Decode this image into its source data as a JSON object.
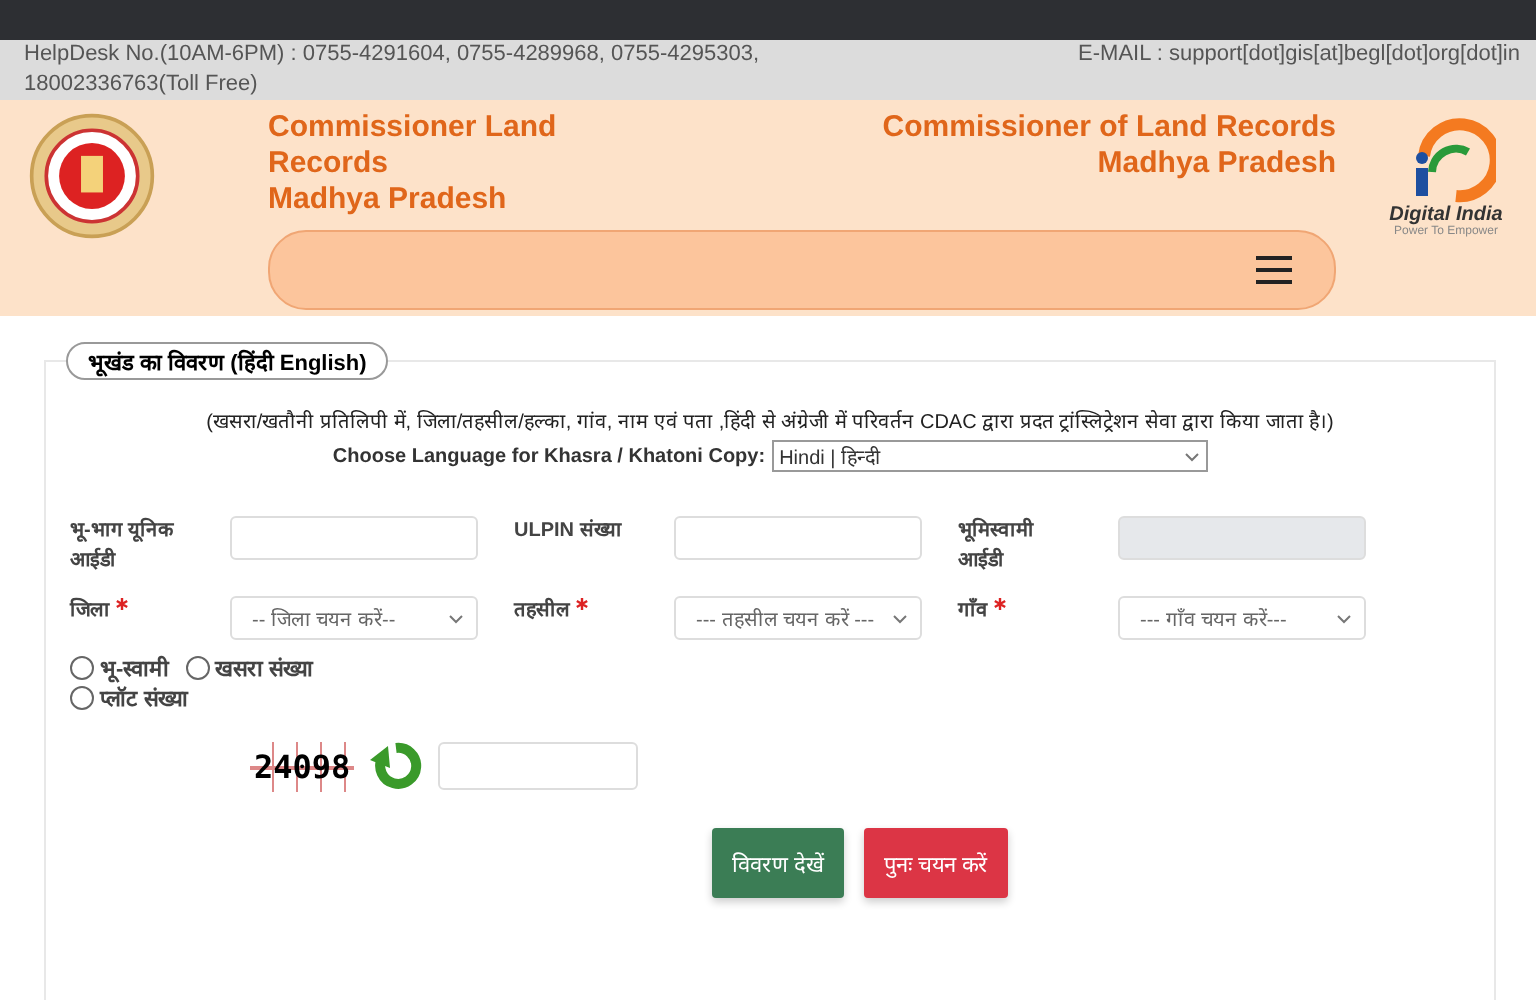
{
  "helpdesk": {
    "phones": "HelpDesk No.(10AM-6PM) : 0755-4291604, 0755-4289968, 0755-4295303, 18002336763(Toll Free)",
    "email": "E-MAIL : support[dot]gis[at]begl[dot]org[dot]in"
  },
  "header": {
    "title_left": [
      "Commissioner Land",
      "Records",
      "Madhya Pradesh"
    ],
    "title_right": [
      "Commissioner of Land Records",
      "Madhya Pradesh"
    ],
    "logo_text": "Digital India",
    "logo_tagline": "Power To Empower"
  },
  "form": {
    "legend": "भूखंड का विवरण  (हिंदी   English)",
    "note": "(खसरा/खतौनी प्रतिलिपी में, जिला/तहसील/हल्का, गांव, नाम एवं पता ,हिंदी से अंग्रेजी में परिवर्तन CDAC द्वारा प्रदत ट्रांस्लिट्रेशन सेवा द्वारा किया जाता है।)",
    "language_label": "Choose Language for Khasra / Khatoni Copy:",
    "language_value": "Hindi | हिन्दी",
    "fields": [
      {
        "kind": "input",
        "label": "भू-भाग यूनिक आईडी",
        "required": false,
        "disabled": false
      },
      {
        "kind": "input",
        "label": "ULPIN संख्या",
        "required": false,
        "disabled": false
      },
      {
        "kind": "input",
        "label": "भूमिस्वामी आईडी",
        "required": false,
        "disabled": true
      },
      {
        "kind": "select",
        "label": "जिला",
        "required": true,
        "value": "-- जिला चयन करें--"
      },
      {
        "kind": "select",
        "label": "तहसील",
        "required": true,
        "value": "--- तहसील चयन करें ---"
      },
      {
        "kind": "select",
        "label": "गाँव",
        "required": true,
        "value": "--- गाँव चयन करें---"
      }
    ],
    "search_by": [
      {
        "label": "भू-स्वामी",
        "selected": false
      },
      {
        "label": "खसरा संख्या",
        "selected": false
      },
      {
        "label": "प्लॉट संख्या",
        "selected": false
      }
    ],
    "captcha": "24098",
    "buttons": [
      {
        "kind": "primary",
        "label": "विवरण देखें"
      },
      {
        "kind": "danger",
        "label": "पुनः चयन करें"
      }
    ]
  }
}
